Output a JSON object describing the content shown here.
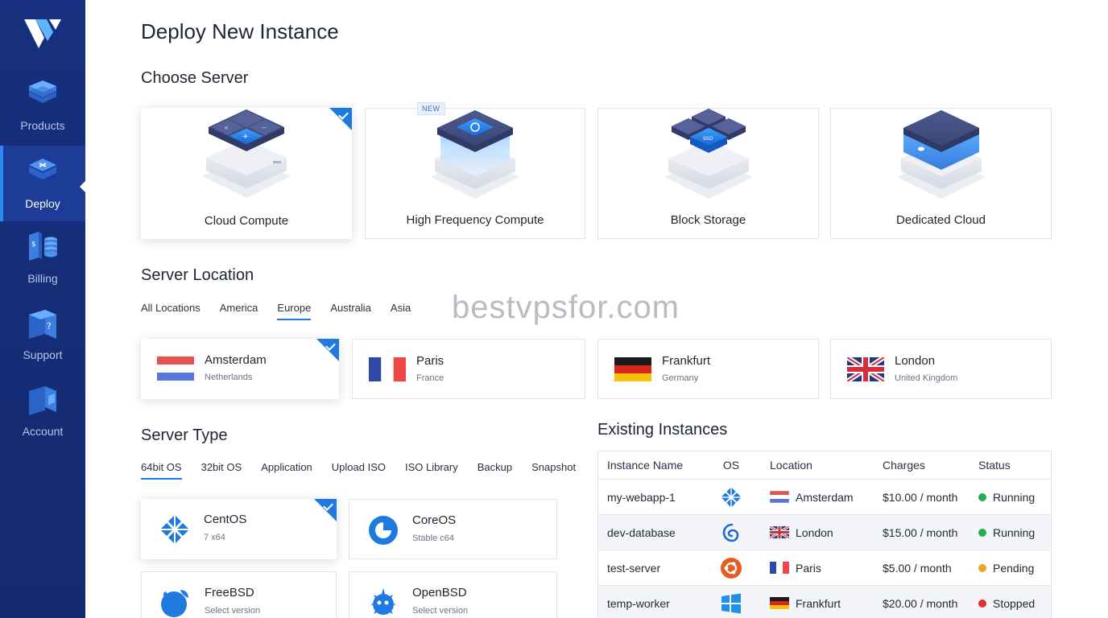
{
  "nav": {
    "items": [
      {
        "label": "Products",
        "icon": "layers-icon"
      },
      {
        "label": "Deploy",
        "icon": "deploy-icon",
        "active": true
      },
      {
        "label": "Billing",
        "icon": "billing-icon"
      },
      {
        "label": "Support",
        "icon": "support-icon"
      },
      {
        "label": "Account",
        "icon": "account-icon"
      }
    ]
  },
  "page": {
    "title": "Deploy New Instance"
  },
  "choose_server": {
    "title": "Choose Server",
    "new_badge": "NEW",
    "options": [
      {
        "label": "Cloud Compute",
        "selected": true
      },
      {
        "label": "High Frequency Compute",
        "badge": "NEW"
      },
      {
        "label": "Block Storage"
      },
      {
        "label": "Dedicated Cloud"
      }
    ]
  },
  "location": {
    "title": "Server Location",
    "tabs": [
      "All Locations",
      "America",
      "Europe",
      "Australia",
      "Asia"
    ],
    "active_tab": "Europe",
    "cards": [
      {
        "city": "Amsterdam",
        "country": "Netherlands",
        "selected": true
      },
      {
        "city": "Paris",
        "country": "France"
      },
      {
        "city": "Frankfurt",
        "country": "Germany"
      },
      {
        "city": "London",
        "country": "United Kingdom"
      }
    ]
  },
  "server_type": {
    "title": "Server Type",
    "tabs": [
      "64bit OS",
      "32bit OS",
      "Application",
      "Upload ISO",
      "ISO Library",
      "Backup",
      "Snapshot"
    ],
    "active_tab": "64bit OS",
    "os": [
      {
        "name": "CentOS",
        "sub": "7 x64",
        "selected": true
      },
      {
        "name": "CoreOS",
        "sub": "Stable c64"
      },
      {
        "name": "FreeBSD",
        "sub": "Select version"
      },
      {
        "name": "OpenBSD",
        "sub": "Select version"
      }
    ]
  },
  "watermark": "bestvpsfor.com",
  "instances": {
    "title": "Existing Instances",
    "columns": [
      "Instance Name",
      "OS",
      "Location",
      "Charges",
      "Status"
    ],
    "rows": [
      {
        "name": "my-webapp-1",
        "os": "centos",
        "location": "Amsterdam",
        "charges": "$10.00 / month",
        "status": "Running"
      },
      {
        "name": "dev-database",
        "os": "debian",
        "location": "London",
        "charges": "$15.00 / month",
        "status": "Running"
      },
      {
        "name": "test-server",
        "os": "ubuntu",
        "location": "Paris",
        "charges": "$5.00 / month",
        "status": "Pending"
      },
      {
        "name": "temp-worker",
        "os": "windows",
        "location": "Frankfurt",
        "charges": "$20.00 / month",
        "status": "Stopped"
      }
    ]
  },
  "colors": {
    "sidebar": "#17307f",
    "accent": "#1f7ae0",
    "running": "#22b04b",
    "pending": "#f2a21b",
    "stopped": "#e0312e"
  }
}
